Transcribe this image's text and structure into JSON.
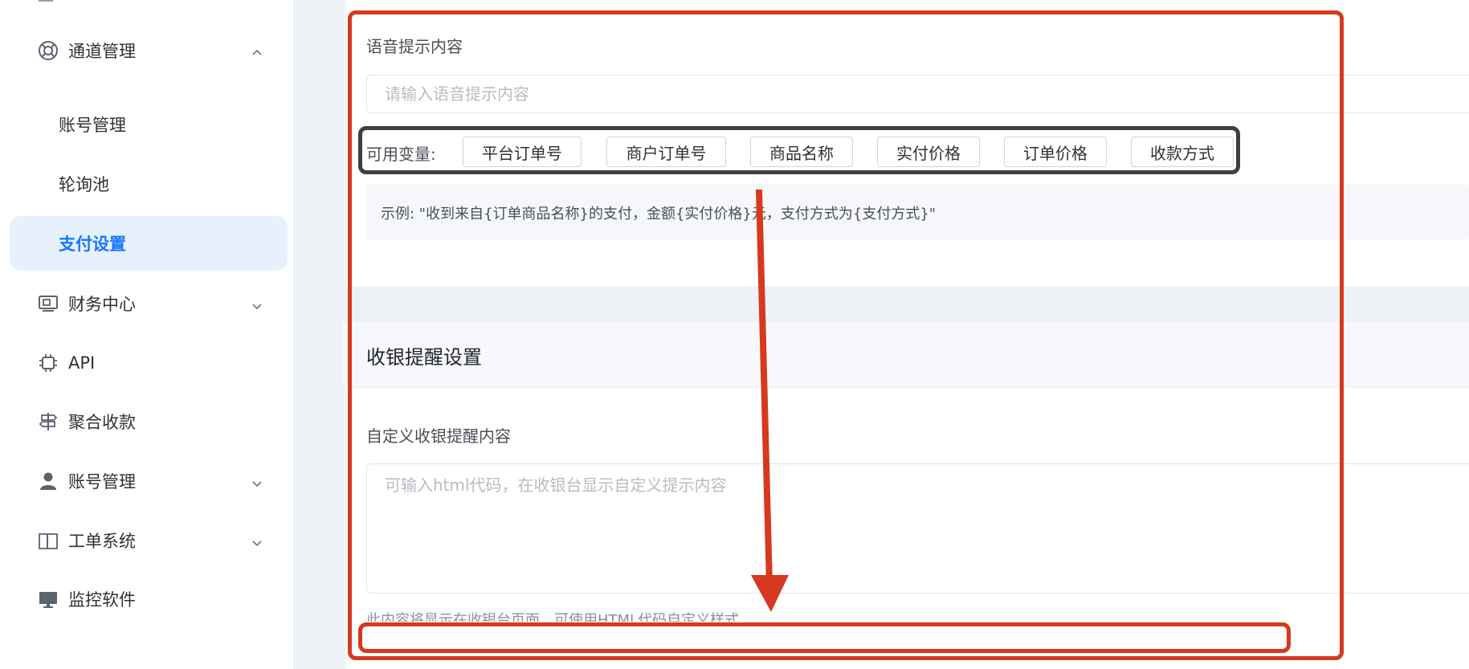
{
  "sidebar": {
    "channel_management": {
      "label": "通道管理",
      "icon": "lifebuoy-icon",
      "expanded": true
    },
    "sub_items": [
      {
        "label": "账号管理"
      },
      {
        "label": "轮询池"
      },
      {
        "label": "支付设置",
        "active": true
      }
    ],
    "items": [
      {
        "label": "财务中心",
        "icon": "finance-monitor-icon"
      },
      {
        "label": "API",
        "icon": "chip-icon"
      },
      {
        "label": "聚合收款",
        "icon": "signpost-icon"
      },
      {
        "label": "账号管理",
        "icon": "user-icon"
      },
      {
        "label": "工单系统",
        "icon": "book-icon"
      },
      {
        "label": "监控软件",
        "icon": "monitor-icon"
      }
    ]
  },
  "voice": {
    "label": "语音提示内容",
    "placeholder": "请输入语音提示内容",
    "vars_label": "可用变量:",
    "variables": [
      "平台订单号",
      "商户订单号",
      "商品名称",
      "实付价格",
      "订单价格",
      "收款方式"
    ],
    "example": "示例: \"收到来自{订单商品名称}的支付，金额{实付价格}元，支付方式为{支付方式}\""
  },
  "cashier": {
    "title": "收银提醒设置",
    "label": "自定义收银提醒内容",
    "placeholder": "可输入html代码，在收银台显示自定义提示内容",
    "hint": "此内容将显示在收银台页面，可使用HTML代码自定义样式"
  },
  "colors": {
    "accent": "#1677ff",
    "active_bg": "#e6f1fd",
    "annotation_red": "#d6391f",
    "annotation_dark": "#3f3f3f"
  }
}
